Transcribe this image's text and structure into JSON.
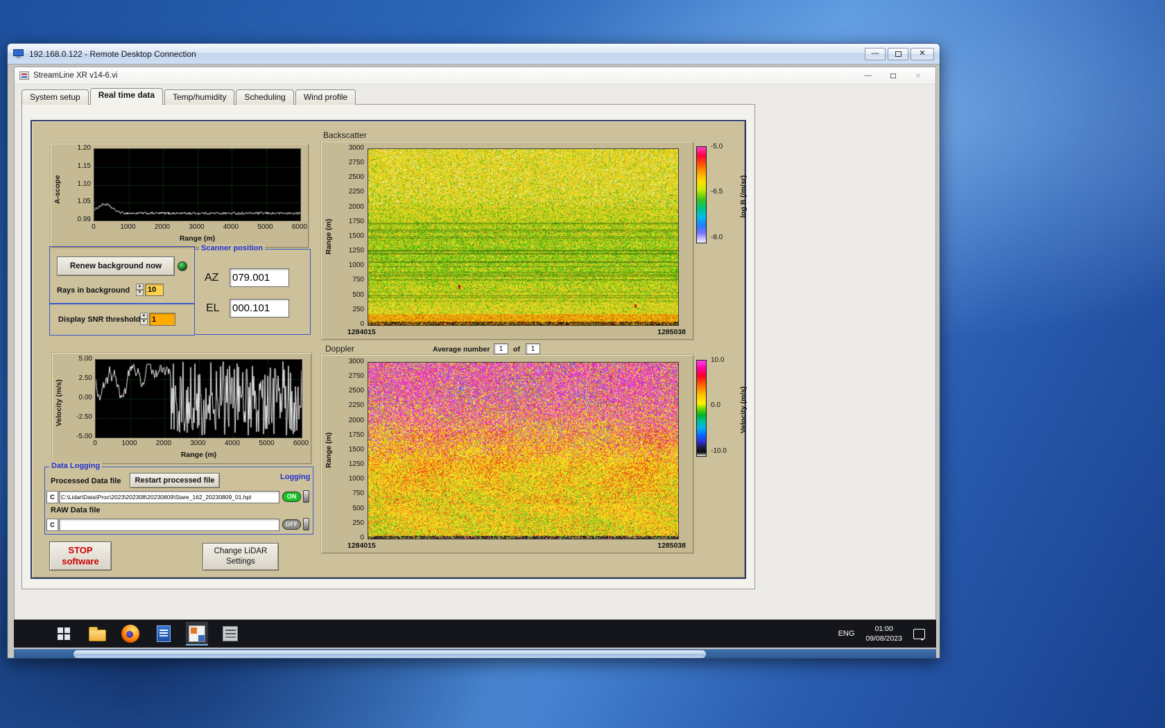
{
  "rdp": {
    "title": "192.168.0.122 - Remote Desktop Connection",
    "controls": {
      "minimize": "—",
      "close": "✕"
    }
  },
  "app": {
    "title": "StreamLine XR v14-6.vi",
    "controls": {
      "minimize": "—",
      "close": "✕"
    },
    "active_tab": "Real time data",
    "tabs": [
      {
        "label": "System setup"
      },
      {
        "label": "Real time data"
      },
      {
        "label": "Temp/humidity"
      },
      {
        "label": "Scheduling"
      },
      {
        "label": "Wind profile"
      }
    ]
  },
  "ascope": {
    "ylabel": "A-scope",
    "xlabel": "Range (m)",
    "yticks": [
      "1.20",
      "1.15",
      "1.10",
      "1.05",
      "0.99"
    ],
    "xticks": [
      "0",
      "1000",
      "2000",
      "3000",
      "4000",
      "5000",
      "6000"
    ]
  },
  "background_controls": {
    "renew_button": "Renew background now",
    "rays_label": "Rays in background",
    "rays_value": "10",
    "snr_label": "Display SNR threshold",
    "snr_value": "1"
  },
  "scanner": {
    "title": "Scanner position",
    "az_label": "AZ",
    "az_value": "079.001",
    "el_label": "EL",
    "el_value": "000.101"
  },
  "backscatter": {
    "title": "Backscatter",
    "ylabel": "Range (m)",
    "yticks": [
      "3000",
      "2750",
      "2500",
      "2250",
      "2000",
      "1750",
      "1500",
      "1250",
      "1000",
      "750",
      "500",
      "250",
      "0"
    ],
    "x_start": "1284015",
    "x_end": "1285038",
    "colorbar_ticks": [
      "-5.0",
      "-6.5",
      "-8.0"
    ],
    "colorbar_label": "log B (/m/sr)"
  },
  "doppler": {
    "title": "Doppler",
    "avg_label": "Average number",
    "avg_value": "1",
    "of_label": "of",
    "count_value": "1",
    "ylabel": "Range (m)",
    "yticks": [
      "3000",
      "2750",
      "2500",
      "2250",
      "2000",
      "1750",
      "1500",
      "1250",
      "1000",
      "750",
      "500",
      "250",
      "0"
    ],
    "x_start": "1284015",
    "x_end": "1285038",
    "colorbar_ticks": [
      "10.0",
      "0.0",
      "-10.0"
    ],
    "colorbar_label": "Velocity (m/s)"
  },
  "velocity_plot": {
    "ylabel": "Velocity (m/s)",
    "xlabel": "Range (m)",
    "yticks": [
      "5.00",
      "2.50",
      "0.00",
      "-2.50",
      "-5.00"
    ],
    "xticks": [
      "0",
      "1000",
      "2000",
      "3000",
      "4000",
      "5000",
      "6000"
    ]
  },
  "data_logging": {
    "title": "Data Logging",
    "processed_label": "Processed Data file",
    "restart_button": "Restart processed file",
    "drive_label": "C",
    "processed_path": "C:\\Lidar\\Data\\Proc\\2023\\202308\\20230809\\Stare_162_20230809_01.hpl",
    "raw_label": "RAW Data file",
    "raw_path": "",
    "logging_label": "Logging",
    "on_label": "ON",
    "off_label": "OFF"
  },
  "actions": {
    "stop_line1": "STOP",
    "stop_line2": "software",
    "change_line1": "Change LiDAR",
    "change_line2": "Settings"
  },
  "taskbar": {
    "language": "ENG",
    "time": "01:00",
    "date": "09/08/2023"
  },
  "ui": {
    "spinner_up": "▲",
    "spinner_down": "▼"
  },
  "colors": {
    "panel_tan": "#cdc19c",
    "group_border_blue": "#3a57c8",
    "label_blue": "#2233cc",
    "on_green": "#17c322",
    "rays_yellow": "#ffd24d",
    "snr_orange": "#ffaa00",
    "stop_red": "#cc0000",
    "desktop_blue": "#2f6bbd"
  }
}
